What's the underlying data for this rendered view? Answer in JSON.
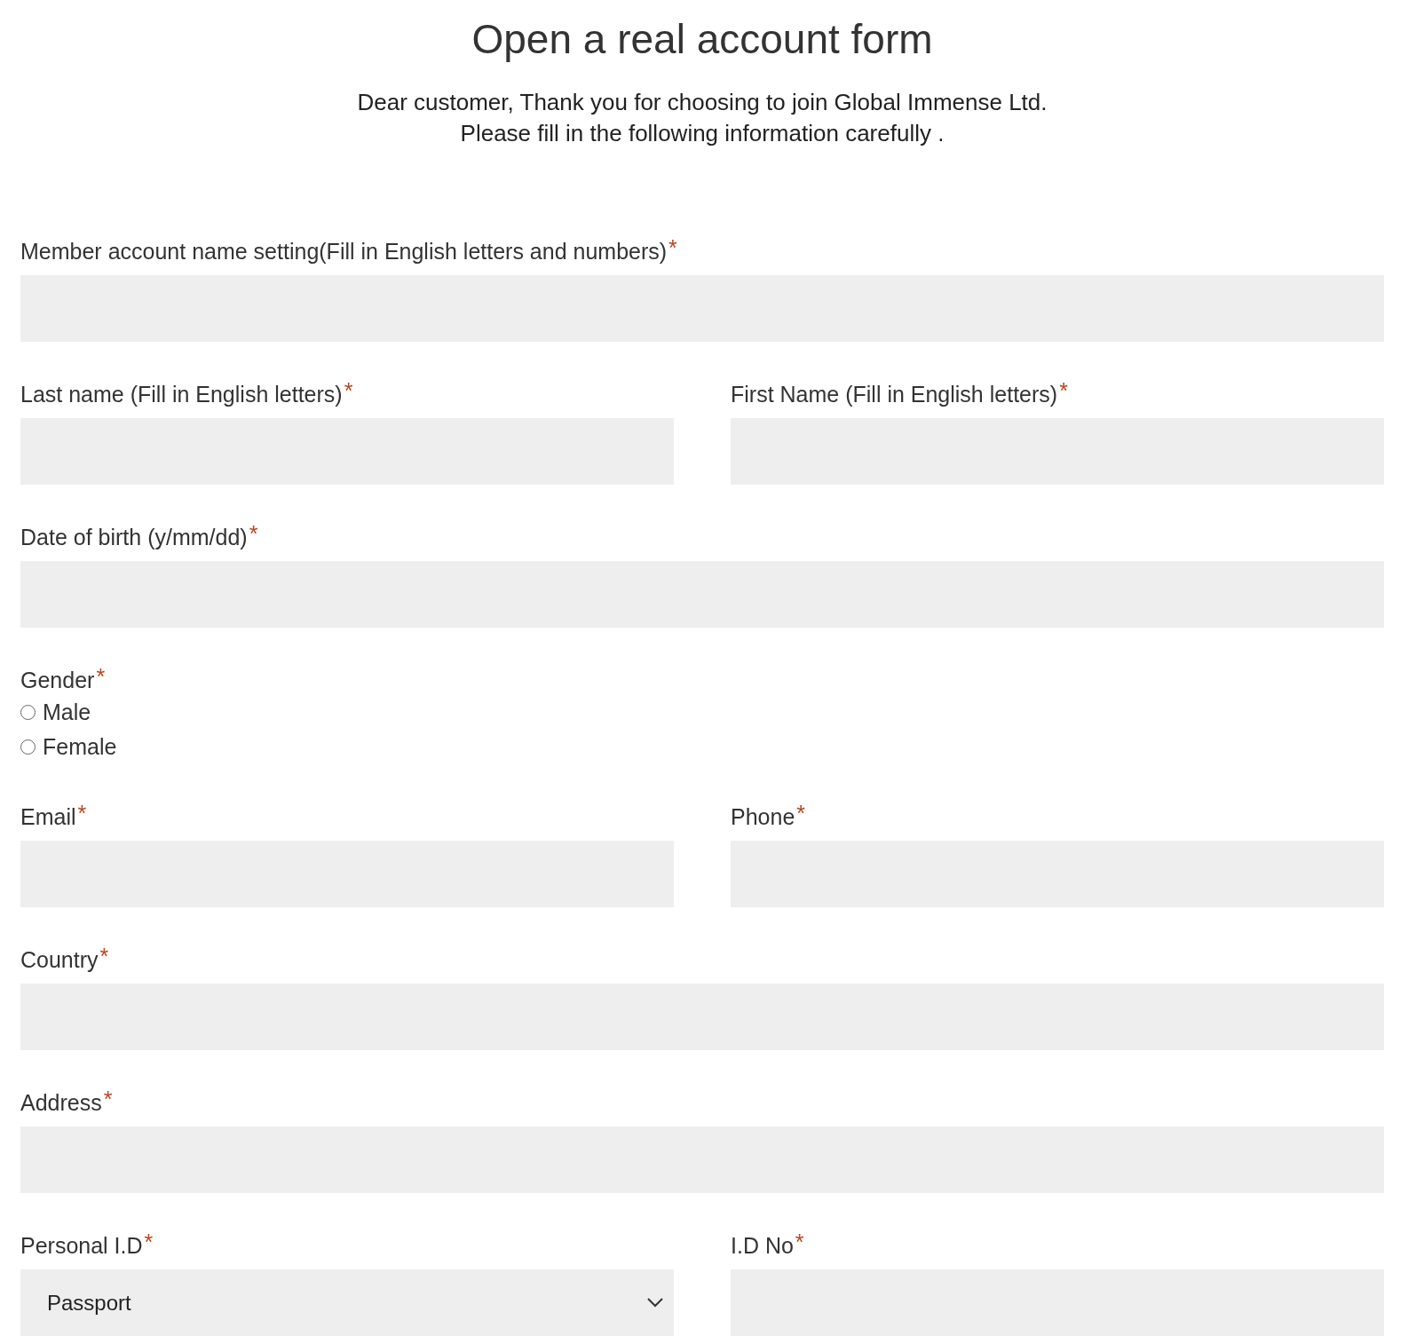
{
  "title": "Open a real account form",
  "intro": [
    "Dear customer, Thank you for choosing to join Global Immense Ltd.",
    "Please fill in the following information carefully ."
  ],
  "rows": [
    {
      "fields": [
        {
          "kind": "text",
          "label": "Member account name setting(Fill in English letters and numbers)",
          "asterisk": "*"
        }
      ]
    },
    {
      "fields": [
        {
          "kind": "text",
          "label": "Last name (Fill in English letters)",
          "asterisk": "*"
        },
        {
          "kind": "text",
          "label": "First Name (Fill in English letters)",
          "asterisk": "*"
        }
      ]
    },
    {
      "fields": [
        {
          "kind": "text",
          "label": "Date of birth (y/mm/dd)",
          "asterisk": "*"
        }
      ]
    },
    {
      "fields": [
        {
          "kind": "radio",
          "label": "Gender",
          "asterisk": "*",
          "options": [
            {
              "label": "Male",
              "selected": false
            },
            {
              "label": "Female",
              "selected": false
            }
          ]
        }
      ]
    },
    {
      "fields": [
        {
          "kind": "text",
          "label": "Email",
          "asterisk": "*"
        },
        {
          "kind": "text",
          "label": "Phone",
          "asterisk": "*"
        }
      ]
    },
    {
      "fields": [
        {
          "kind": "text",
          "label": "Country",
          "asterisk": "*"
        }
      ]
    },
    {
      "fields": [
        {
          "kind": "text",
          "label": "Address",
          "asterisk": "*"
        }
      ]
    },
    {
      "fields": [
        {
          "kind": "select",
          "label": "Personal I.D",
          "asterisk": "*",
          "value": "Passport"
        },
        {
          "kind": "text",
          "label": "I.D No",
          "asterisk": "*"
        }
      ]
    }
  ]
}
